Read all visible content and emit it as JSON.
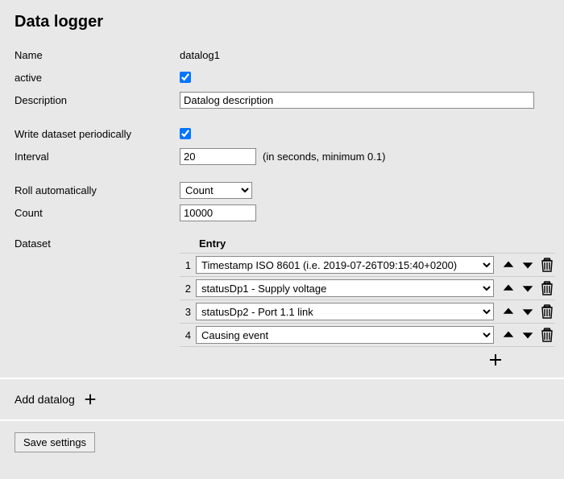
{
  "title": "Data logger",
  "labels": {
    "name": "Name",
    "active": "active",
    "description": "Description",
    "write_periodic": "Write dataset periodically",
    "interval": "Interval",
    "interval_hint": "(in seconds, minimum 0.1)",
    "roll_auto": "Roll automatically",
    "count": "Count",
    "dataset": "Dataset",
    "entry": "Entry",
    "add_datalog": "Add datalog",
    "save": "Save settings"
  },
  "form": {
    "name": "datalog1",
    "active": true,
    "description": "Datalog description",
    "write_periodic": true,
    "interval": "20",
    "roll_mode": "Count",
    "count": "10000"
  },
  "dataset": {
    "entries": [
      {
        "n": "1",
        "value": "Timestamp ISO 8601 (i.e. 2019-07-26T09:15:40+0200)"
      },
      {
        "n": "2",
        "value": "statusDp1 - Supply voltage"
      },
      {
        "n": "3",
        "value": "statusDp2 - Port 1.1 link"
      },
      {
        "n": "4",
        "value": "Causing event"
      }
    ]
  }
}
